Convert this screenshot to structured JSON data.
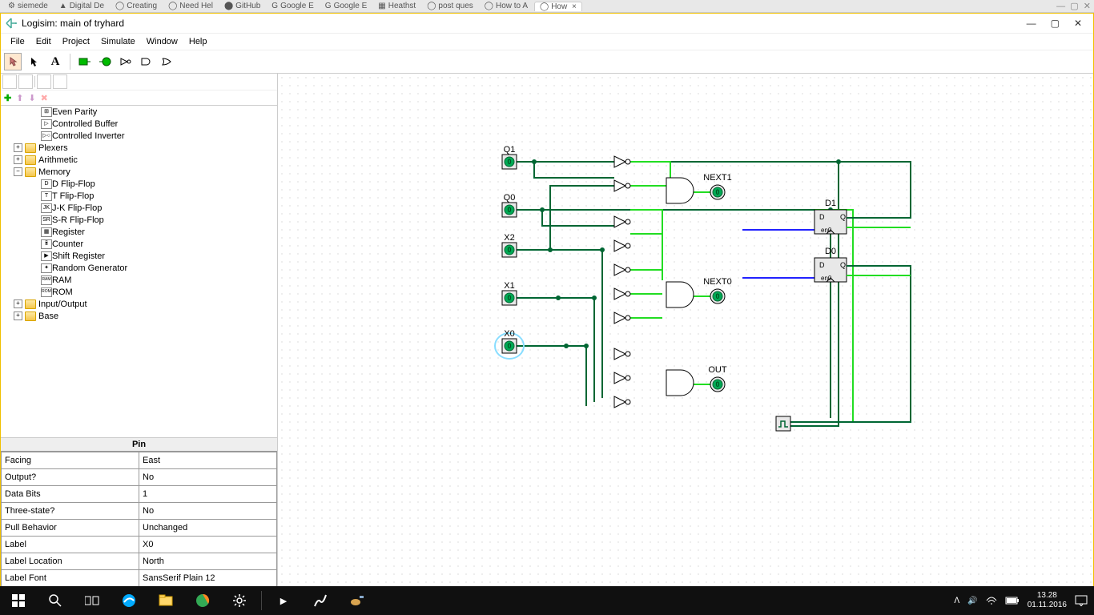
{
  "browserTabs": [
    "siemede",
    "Digital De",
    "Creating",
    "Need Hel",
    "GitHub",
    "Google E",
    "Google E",
    "Heathst",
    "post ques",
    "How to A",
    "How"
  ],
  "window": {
    "title": "Logisim: main of tryhard"
  },
  "menu": [
    "File",
    "Edit",
    "Project",
    "Simulate",
    "Window",
    "Help"
  ],
  "toolbarLetter": "A",
  "tree": {
    "topItems": [
      "Even Parity",
      "Controlled Buffer",
      "Controlled Inverter"
    ],
    "folders": [
      "Plexers",
      "Arithmetic",
      "Memory"
    ],
    "memoryItems": [
      "D Flip-Flop",
      "T Flip-Flop",
      "J-K Flip-Flop",
      "S-R Flip-Flop",
      "Register",
      "Counter",
      "Shift Register",
      "Random Generator",
      "RAM",
      "ROM"
    ],
    "memoryIcons": [
      "D",
      "T",
      "JK",
      "SR",
      "▦",
      "𝄝",
      "▶",
      "✦",
      "RAM",
      "ROM"
    ],
    "bottomFolders": [
      "Input/Output",
      "Base"
    ]
  },
  "properties": {
    "header": "Pin",
    "rows": [
      {
        "k": "Facing",
        "v": "East"
      },
      {
        "k": "Output?",
        "v": "No"
      },
      {
        "k": "Data Bits",
        "v": "1"
      },
      {
        "k": "Three-state?",
        "v": "No"
      },
      {
        "k": "Pull Behavior",
        "v": "Unchanged"
      },
      {
        "k": "Label",
        "v": "X0"
      },
      {
        "k": "Label Location",
        "v": "North"
      },
      {
        "k": "Label Font",
        "v": "SansSerif Plain 12"
      }
    ]
  },
  "circuit": {
    "pins": [
      "Q1",
      "Q0",
      "X2",
      "X1",
      "X0"
    ],
    "outputs": [
      "NEXT1",
      "NEXT0",
      "OUT"
    ],
    "ff": [
      "D1",
      "D0"
    ],
    "ffText": {
      "d": "D",
      "q": "Q",
      "en": "en0"
    }
  },
  "taskbar": {
    "time": "13.28",
    "date": "01.11.2016"
  }
}
